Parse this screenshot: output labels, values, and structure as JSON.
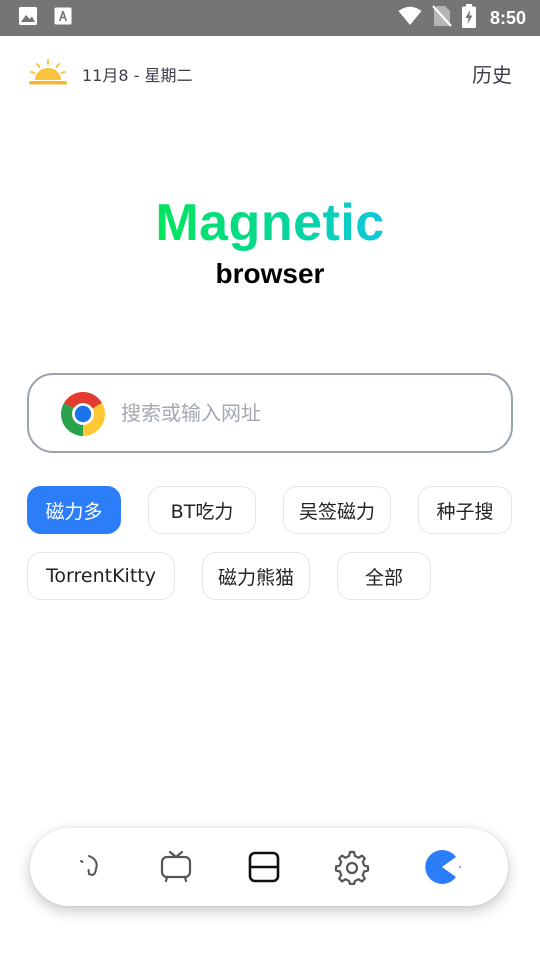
{
  "status_bar": {
    "time": "8:50",
    "icons": [
      "image-icon",
      "a-letter-icon",
      "wifi-icon",
      "no-sim-icon",
      "battery-charging-icon"
    ]
  },
  "header": {
    "date": "11月8 - 星期二",
    "history_label": "历史",
    "weather_icon": "sun-rising-icon"
  },
  "brand": {
    "title": "Magnetic",
    "subtitle": "browser",
    "gradient": [
      "#00e65a",
      "#0ec8df"
    ]
  },
  "search": {
    "value": "",
    "placeholder": "搜索或输入网址",
    "logo_icon": "chrome-icon"
  },
  "engines": {
    "items": [
      {
        "label": "磁力多",
        "active": true
      },
      {
        "label": "BT吃力",
        "active": false
      },
      {
        "label": "吴签磁力",
        "active": false
      },
      {
        "label": "种子搜",
        "active": false
      },
      {
        "label": "TorrentKitty",
        "active": false
      },
      {
        "label": "磁力熊猫",
        "active": false
      },
      {
        "label": "全部",
        "active": false
      }
    ],
    "active_color": "#2c7ef8"
  },
  "bottom_nav": {
    "items": [
      "back-icon",
      "tv-icon",
      "tabs-icon",
      "gear-icon",
      "pacman-icon"
    ],
    "accent_color": "#2c7ef8"
  }
}
